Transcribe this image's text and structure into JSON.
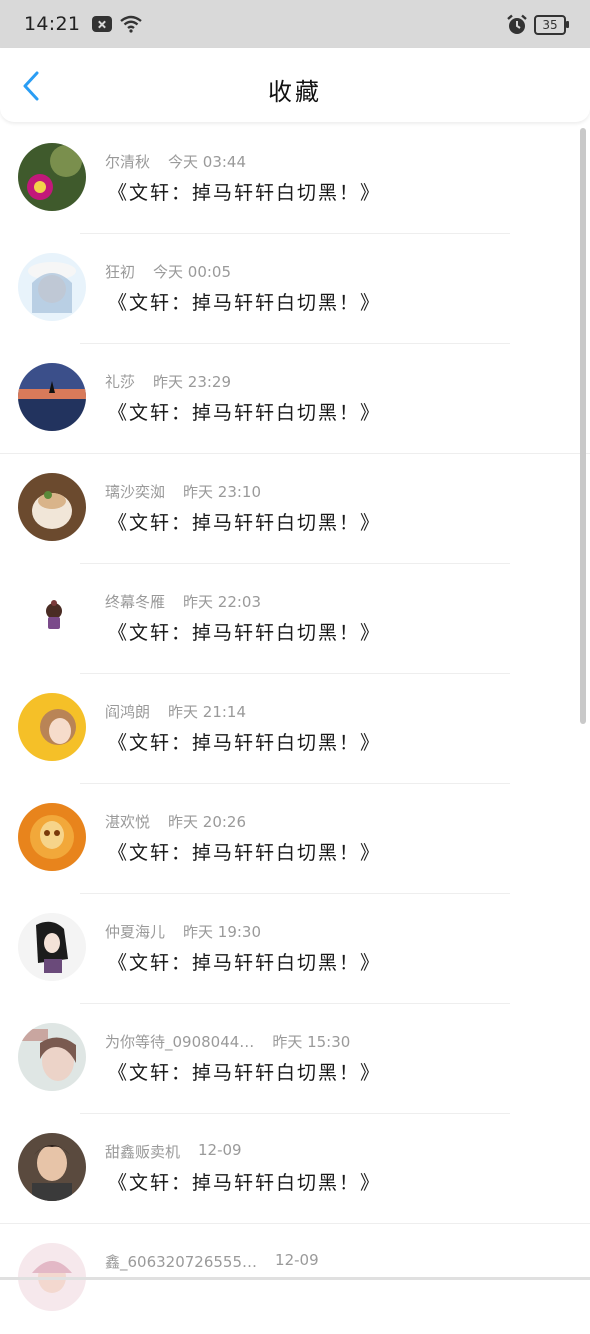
{
  "status_bar": {
    "time": "14:21",
    "battery": "35"
  },
  "header": {
    "title": "收藏"
  },
  "items": [
    {
      "name": "尔清秋",
      "time": "今天 03:44",
      "message": "《文轩：掉马轩轩白切黑！》"
    },
    {
      "name": "狂初",
      "time": "今天 00:05",
      "message": "《文轩：掉马轩轩白切黑！》"
    },
    {
      "name": "礼莎",
      "time": "昨天 23:29",
      "message": "《文轩：掉马轩轩白切黑！》"
    },
    {
      "name": "璃沙奕洳",
      "time": "昨天 23:10",
      "message": "《文轩：掉马轩轩白切黑！》"
    },
    {
      "name": "终幕冬雁",
      "time": "昨天 22:03",
      "message": "《文轩：掉马轩轩白切黑！》"
    },
    {
      "name": "阎鸿朗",
      "time": "昨天 21:14",
      "message": "《文轩：掉马轩轩白切黑！》"
    },
    {
      "name": "湛欢悦",
      "time": "昨天 20:26",
      "message": "《文轩：掉马轩轩白切黑！》"
    },
    {
      "name": "仲夏海儿",
      "time": "昨天 19:30",
      "message": "《文轩：掉马轩轩白切黑！》"
    },
    {
      "name": "为你等待_0908044…",
      "time": "昨天 15:30",
      "message": "《文轩：掉马轩轩白切黑！》"
    },
    {
      "name": "甜鑫贩卖机",
      "time": "12-09",
      "message": "《文轩：掉马轩轩白切黑！》"
    },
    {
      "name": "鑫_606320726555…",
      "time": "12-09",
      "message": ""
    }
  ]
}
